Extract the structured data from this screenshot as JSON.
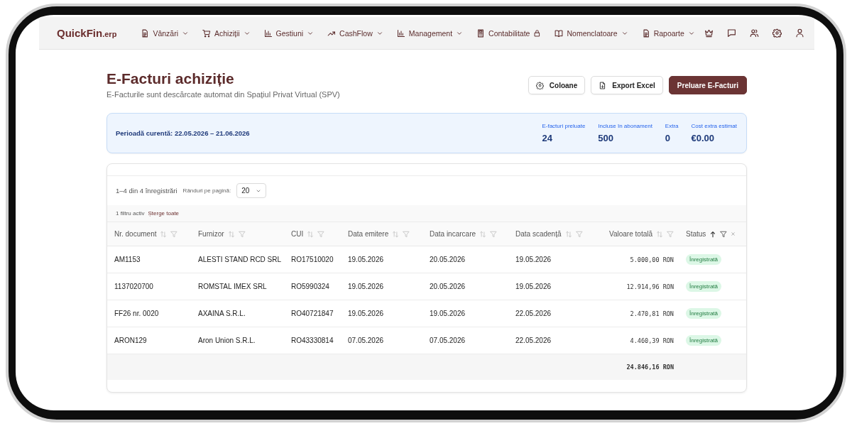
{
  "app": {
    "logo": "QuickFin",
    "logo_suffix": ".erp"
  },
  "nav": {
    "items": [
      {
        "label": "Vânzări",
        "kind": "dropdown"
      },
      {
        "label": "Achiziții",
        "kind": "dropdown"
      },
      {
        "label": "Gestiuni",
        "kind": "dropdown"
      },
      {
        "label": "CashFlow",
        "kind": "dropdown"
      },
      {
        "label": "Management",
        "kind": "dropdown"
      },
      {
        "label": "Contabilitate",
        "kind": "locked"
      },
      {
        "label": "Nomenclatoare",
        "kind": "dropdown"
      },
      {
        "label": "Rapoarte",
        "kind": "dropdown"
      }
    ]
  },
  "page": {
    "title": "E-Facturi achiziție",
    "subtitle": "E-Facturile sunt descărcate automat din Spațiul Privat Virtual (SPV)",
    "buttons": [
      {
        "label": "Coloane",
        "kind": "secondary"
      },
      {
        "label": "Export Excel",
        "kind": "secondary"
      },
      {
        "label": "Preluare E-Facturi",
        "kind": "primary"
      }
    ]
  },
  "summary": {
    "period": "Perioadă curentă: 22.05.2026 – 21.06.2026",
    "stats": [
      {
        "label": "E-facturi preluate",
        "value": "24"
      },
      {
        "label": "Incluse în abonament",
        "value": "500"
      },
      {
        "label": "Extra",
        "value": "0"
      },
      {
        "label": "Cost extra estimat",
        "value": "€0.00"
      }
    ]
  },
  "table": {
    "range": "1–4 din 4 înregistrări",
    "page_size_label": "Rânduri pe pagină:",
    "page_size": "20",
    "filter_count": "1 filtru activ",
    "clear_filters": "Șterge toate",
    "columns": [
      {
        "label": "Nr. document",
        "kind": "text",
        "sorted": false,
        "filtered": false
      },
      {
        "label": "Furnizor",
        "kind": "text",
        "sorted": false,
        "filtered": false
      },
      {
        "label": "CUI",
        "kind": "text",
        "sorted": false,
        "filtered": false
      },
      {
        "label": "Data emitere",
        "kind": "text",
        "sorted": false,
        "filtered": false
      },
      {
        "label": "Data incarcare",
        "kind": "text",
        "sorted": false,
        "filtered": false
      },
      {
        "label": "Data scadență",
        "kind": "text",
        "sorted": false,
        "filtered": false
      },
      {
        "label": "Valoare totală",
        "kind": "amount",
        "sorted": false,
        "filtered": false
      },
      {
        "label": "Status",
        "kind": "status",
        "sorted": true,
        "filtered": true
      }
    ],
    "rows": [
      {
        "cells": [
          "AM1153",
          "ALESTI STAND RCD SRL",
          "RO17510020",
          "19.05.2026",
          "20.05.2026",
          "19.05.2026",
          "5.000,00 RON",
          "Înregistrată"
        ]
      },
      {
        "cells": [
          "1137020700",
          "ROMSTAL IMEX SRL",
          "RO5990324",
          "19.05.2026",
          "20.05.2026",
          "19.05.2026",
          "12.914,96 RON",
          "Înregistrată"
        ]
      },
      {
        "cells": [
          "FF26 nr. 0020",
          "AXAINA S.R.L.",
          "RO40721847",
          "19.05.2026",
          "19.05.2026",
          "22.05.2026",
          "2.470,81 RON",
          "Înregistrată"
        ]
      },
      {
        "cells": [
          "ARON129",
          "Aron Union S.R.L.",
          "RO43330814",
          "07.05.2026",
          "07.05.2026",
          "22.05.2026",
          "4.460,39 RON",
          "Înregistrată"
        ]
      }
    ],
    "total": "24.846,16 RON"
  }
}
